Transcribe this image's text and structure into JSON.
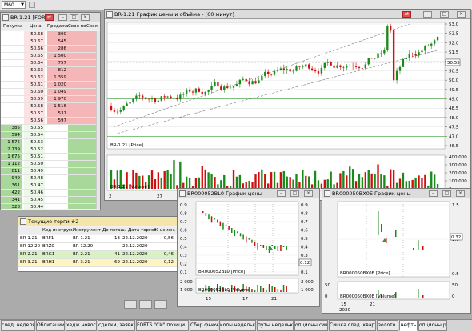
{
  "toolbar": {
    "interval_value": "M60"
  },
  "orderbook": {
    "title": "BR-1.21 [FORTS]",
    "headers": [
      "Покупка",
      "Цена",
      "Продажа",
      "Своя по",
      "Своя"
    ],
    "sell_rows": [
      {
        "price": "50.68",
        "vol": "300"
      },
      {
        "price": "50.67",
        "vol": "545"
      },
      {
        "price": "50.66",
        "vol": "286"
      },
      {
        "price": "50.65",
        "vol": "1 500"
      },
      {
        "price": "50.64",
        "vol": "757"
      },
      {
        "price": "50.63",
        "vol": "812"
      },
      {
        "price": "50.62",
        "vol": "1 359"
      },
      {
        "price": "50.61",
        "vol": "1 020"
      },
      {
        "price": "50.60",
        "vol": "1 049"
      },
      {
        "price": "50.59",
        "vol": "1 970"
      },
      {
        "price": "50.58",
        "vol": "1 516"
      },
      {
        "price": "50.57",
        "vol": "531"
      },
      {
        "price": "50.56",
        "vol": "597"
      }
    ],
    "buy_rows": [
      {
        "price": "50.55",
        "vol": "385"
      },
      {
        "price": "50.54",
        "vol": "594"
      },
      {
        "price": "50.53",
        "vol": "1 575"
      },
      {
        "price": "50.52",
        "vol": "2 139"
      },
      {
        "price": "50.51",
        "vol": "1 675"
      },
      {
        "price": "50.50",
        "vol": "1 112"
      },
      {
        "price": "50.49",
        "vol": "811"
      },
      {
        "price": "50.48",
        "vol": "949"
      },
      {
        "price": "50.47",
        "vol": "361"
      },
      {
        "price": "50.46",
        "vol": "422"
      },
      {
        "price": "50.45",
        "vol": "341"
      },
      {
        "price": "50.44",
        "vol": "328"
      }
    ]
  },
  "main_chart": {
    "title": "BR-1.21 График цены и объёма - [60 минут]",
    "price_ticks": [
      "53.0",
      "52.5",
      "52.0",
      "51.5",
      "51.0",
      "50.5",
      "50.0",
      "49.5",
      "49.0",
      "48.5",
      "48.0",
      "47.5",
      "47.0",
      "46.5"
    ],
    "price_label": "50.55",
    "price_legend": "BR-1.21 [Price]",
    "volume_ticks": [
      "400 000",
      "300 000",
      "200 000",
      "100 000",
      "0"
    ],
    "volume_legend": "BR-1.21 [Volume]",
    "time_labels": [
      "2",
      "27"
    ]
  },
  "trades": {
    "title": "Текущие торги #2",
    "columns": [
      "Код инструм.",
      "Инструмент",
      "До погаш.",
      "Дата торгов",
      "% измен."
    ],
    "rows": [
      {
        "code": "BR-1.21",
        "short": "BRF1",
        "name": "BR-1.21",
        "days": "13",
        "date": "22.12.2020",
        "change": "0,56",
        "color": "#ffffff"
      },
      {
        "code": "BR-12.20",
        "short": "BRZ0",
        "name": "BR-12.20",
        "days": "-",
        "date": "22.12.2020",
        "change": "",
        "color": "#ffffff"
      },
      {
        "code": "BR-2.21",
        "short": "BRG1",
        "name": "BR-2.21",
        "days": "41",
        "date": "22.12.2020",
        "change": "0,46",
        "color": "#d9f2c4"
      },
      {
        "code": "BR-3.21",
        "short": "BRH1",
        "name": "BR-3.21",
        "days": "69",
        "date": "22.12.2020",
        "change": "-0,12",
        "color": "#fdf4c0"
      }
    ]
  },
  "chart2": {
    "title": "BR000052BL0 График цены",
    "left_ticks": [
      "0.9",
      "0.8",
      "0.7",
      "0.6",
      "0.5",
      "0.4",
      "0.3",
      "0.2",
      "0.1"
    ],
    "right_ticks": [
      "0.9",
      "0.8",
      "0.7",
      "0.6",
      "0.5",
      "0.4",
      "0.3",
      "0.2",
      "0.1"
    ],
    "price_legend": "BR000052BL0 [Price]",
    "volume_legend": "BR000052BL0 [Volume]",
    "volume_ticks": [
      "2 000",
      "1 000"
    ],
    "volume_ticks_right": [
      "2 000",
      "1 000"
    ],
    "price_label": "0.12",
    "dates": [
      "15",
      "17",
      "21"
    ]
  },
  "chart3": {
    "title": "BR000050BX0E График цены",
    "right_ticks": [
      "1.5",
      "1.0",
      "0.5"
    ],
    "price_label": "0.32",
    "price_legend": "BR000050BX0E [Price]",
    "volume_legend": "BR000050BX0E [Volume]",
    "volume_ticks": [
      "50",
      "0"
    ],
    "volume_ticks_right": [
      "50",
      "0"
    ],
    "dates": [
      "15",
      "21"
    ],
    "year": "2020"
  },
  "tabs": [
    {
      "label": "след. неделя",
      "active": false
    },
    {
      "label": "Облигации",
      "active": false
    },
    {
      "label": "хедж новости",
      "active": false
    },
    {
      "label": "сделки, заявки",
      "active": false
    },
    {
      "label": "FORTS \"СИ\" позици...",
      "active": false
    },
    {
      "label": "Сбер фьюч",
      "active": false
    },
    {
      "label": "колы неделька",
      "active": false
    },
    {
      "label": "путы неделька",
      "active": false
    },
    {
      "label": "опционы сишка",
      "active": false
    },
    {
      "label": "Сишка след. квартал",
      "active": false
    },
    {
      "label": "золото.",
      "active": false
    },
    {
      "label": "нефть",
      "active": true
    },
    {
      "label": "опционы ртс",
      "active": false
    }
  ],
  "colors": {
    "sell_bg": "#f4b6b6",
    "buy_bg": "#a9d99a",
    "candle_up": "#1a8a1a",
    "candle_down": "#d01010",
    "chart_bg": "#ffffff"
  }
}
